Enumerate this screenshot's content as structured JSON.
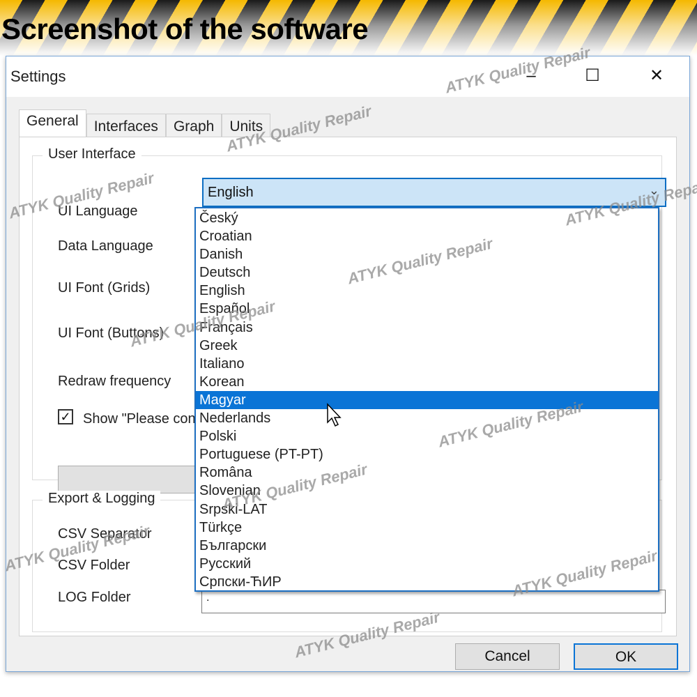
{
  "banner": {
    "title": "Screenshot of the software"
  },
  "window": {
    "title": "Settings",
    "controls": {
      "minimize": "–",
      "maximize": "☐",
      "close": "✕"
    }
  },
  "tabs": [
    {
      "label": "General",
      "active": true
    },
    {
      "label": "Interfaces"
    },
    {
      "label": "Graph"
    },
    {
      "label": "Units"
    }
  ],
  "user_interface": {
    "group_title": "User Interface",
    "ui_language_label": "UI Language",
    "ui_language_value": "English",
    "data_language_label": "Data Language",
    "ui_font_grids_label": "UI Font (Grids)",
    "ui_font_buttons_label": "UI Font (Buttons)",
    "redraw_label": "Redraw frequency",
    "show_please_label": "Show \"Please con",
    "show_please_checked": true
  },
  "export": {
    "group_title": "Export & Logging",
    "csv_separator_label": "CSV Separator",
    "csv_folder_label": "CSV Folder",
    "log_folder_label": "LOG Folder",
    "log_folder_value": "."
  },
  "dropdown": {
    "selected_index": 10,
    "options": [
      "Český",
      "Croatian",
      "Danish",
      "Deutsch",
      "English",
      "Español",
      "Français",
      "Greek",
      "Italiano",
      "Korean",
      "Magyar",
      "Nederlands",
      "Polski",
      "Portuguese (PT-PT)",
      "Româna",
      "Slovenian",
      "Srpski-LAT",
      "Türkçe",
      "Български",
      "Русский",
      "Српски-ЋИР"
    ]
  },
  "buttons": {
    "cancel": "Cancel",
    "ok": "OK"
  },
  "watermark": "ATYK Quality Repair",
  "colors": {
    "accent": "#0a74d6",
    "combo_bg": "#cce4f7"
  }
}
